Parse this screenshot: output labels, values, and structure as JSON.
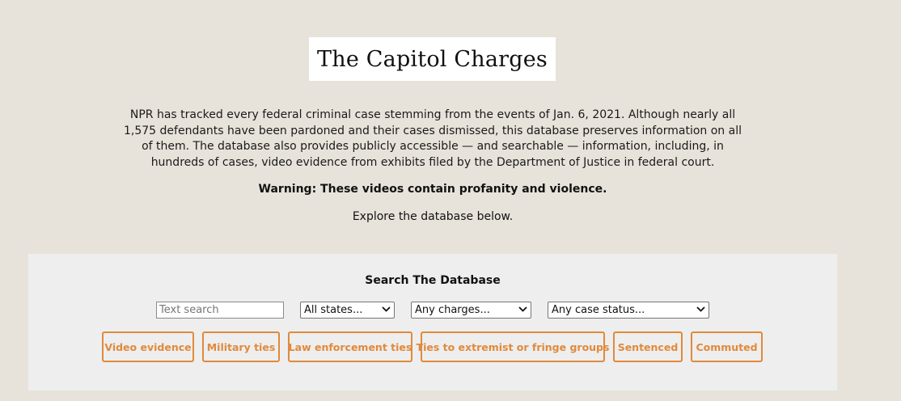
{
  "header": {
    "title": "The Capitol Charges"
  },
  "intro": {
    "paragraph": "NPR has tracked every federal criminal case stemming from the events of Jan. 6, 2021. Although nearly all 1,575 defendants have been pardoned and their cases dismissed, this database preserves information on all of them. The database also provides publicly accessible — and searchable — information, including, in hundreds of cases, video evidence from exhibits filed by the Department of Justice in federal court.",
    "warning": "Warning: These videos contain profanity and violence.",
    "explore": "Explore the database below."
  },
  "search": {
    "heading": "Search The Database",
    "text_placeholder": "Text search",
    "states_selected": "All states...",
    "charges_selected": "Any charges...",
    "status_selected": "Any case status...",
    "filters": [
      {
        "label": "Video evidence"
      },
      {
        "label": "Military ties"
      },
      {
        "label": "Law enforcement ties"
      },
      {
        "label": "Ties to extremist or fringe groups"
      },
      {
        "label": "Sentenced"
      },
      {
        "label": "Commuted"
      }
    ]
  },
  "colors": {
    "background": "#e8e3da",
    "panel": "#eeeeee",
    "accent": "#e08a3c"
  },
  "icons": {
    "select_chevron": "chevron-down-icon"
  }
}
